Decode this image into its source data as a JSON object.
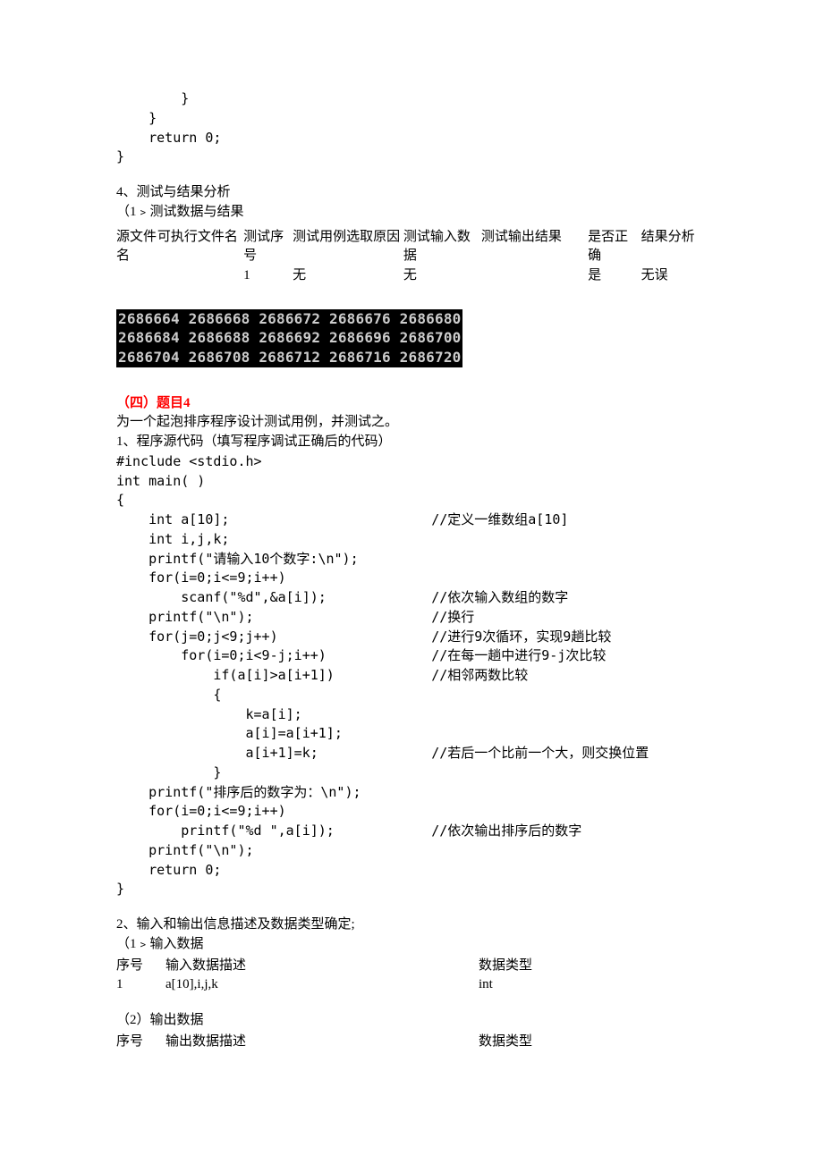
{
  "code_top": "        }\n    }\n    return 0;\n}",
  "sec3": {
    "h1": "4、测试与结果分析",
    "h2": "（1﹥测试数据与结果",
    "table": {
      "headers": [
        "源文件名",
        "可执行文件名",
        "测试序号",
        "测试用例选取原因",
        "测试输入数据",
        "测试输出结果",
        "是否正确",
        "结果分析"
      ],
      "row": [
        "",
        "",
        "1",
        "无",
        "无",
        "",
        "是",
        "无误"
      ]
    }
  },
  "console": "2686664 2686668 2686672 2686676 2686680\n2686684 2686688 2686692 2686696 2686700\n2686704 2686708 2686712 2686716 2686720",
  "q4": {
    "title": "（四）题目4",
    "desc": "为一个起泡排序程序设计测试用例，并测试之。",
    "code_h": "1、程序源代码（填写程序调试正确后的代码）",
    "code": "#include <stdio.h>\nint main( )\n{\n    int a[10];                         //定义一维数组a[10]\n    int i,j,k;\n    printf(\"请输入10个数字:\\n\");\n    for(i=0;i<=9;i++)\n        scanf(\"%d\",&a[i]);             //依次输入数组的数字\n    printf(\"\\n\");                      //换行\n    for(j=0;j<9;j++)                   //进行9次循环，实现9趟比较\n        for(i=0;i<9-j;i++)             //在每一趟中进行9-j次比较\n            if(a[i]>a[i+1])            //相邻两数比较\n            {\n                k=a[i];\n                a[i]=a[i+1];\n                a[i+1]=k;              //若后一个比前一个大，则交换位置\n            }\n    printf(\"排序后的数字为：\\n\");\n    for(i=0;i<=9;i++)\n        printf(\"%d \",a[i]);            //依次输出排序后的数字\n    printf(\"\\n\");\n    return 0;\n}"
  },
  "io": {
    "h": "2、输入和输出信息描述及数据类型确定;",
    "in_h": "（1﹥输入数据",
    "in_tbl": {
      "headers": [
        "序号",
        "输入数据描述",
        "数据类型"
      ],
      "row": [
        "1",
        "a[10],i,j,k",
        "int"
      ]
    },
    "out_h": "（2）输出数据",
    "out_tbl": {
      "headers": [
        "序号",
        "输出数据描述",
        "数据类型"
      ]
    }
  }
}
